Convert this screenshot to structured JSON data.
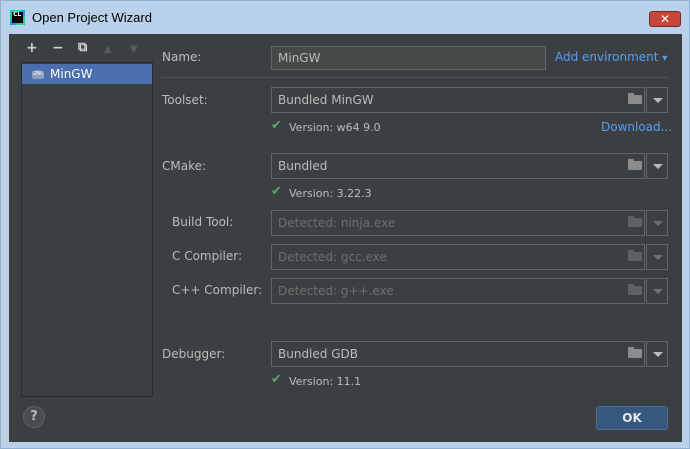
{
  "window": {
    "title": "Open Project Wizard",
    "app_icon_text": "CL"
  },
  "sidebar": {
    "toolbar": {
      "add": "+",
      "remove": "−",
      "copy": "⧉",
      "up": "▲",
      "down": "▼"
    },
    "items": [
      {
        "label": "MinGW",
        "icon_text": "GNU"
      }
    ]
  },
  "form": {
    "name": {
      "label": "Name:",
      "value": "MinGW"
    },
    "add_environment": "Add environment",
    "toolset": {
      "label": "Toolset:",
      "value": "Bundled MinGW",
      "version": "Version: w64 9.0",
      "download": "Download..."
    },
    "cmake": {
      "label": "CMake:",
      "value": "Bundled",
      "version": "Version: 3.22.3"
    },
    "build_tool": {
      "label": "Build Tool:",
      "placeholder": "Detected: ninja.exe"
    },
    "c_compiler": {
      "label": "C Compiler:",
      "placeholder": "Detected: gcc.exe"
    },
    "cpp_compiler": {
      "label": "C++ Compiler:",
      "placeholder": "Detected: g++.exe"
    },
    "debugger": {
      "label": "Debugger:",
      "value": "Bundled GDB",
      "version": "Version: 11.1"
    }
  },
  "footer": {
    "help": "?",
    "ok": "OK"
  },
  "icons": {
    "check": "check-icon",
    "folder": "folder-icon",
    "dropdown": "chevron-down-icon"
  },
  "colors": {
    "accent": "#4b6eaf",
    "link": "#589df6",
    "ok_button": "#365880",
    "check": "#59a869"
  }
}
